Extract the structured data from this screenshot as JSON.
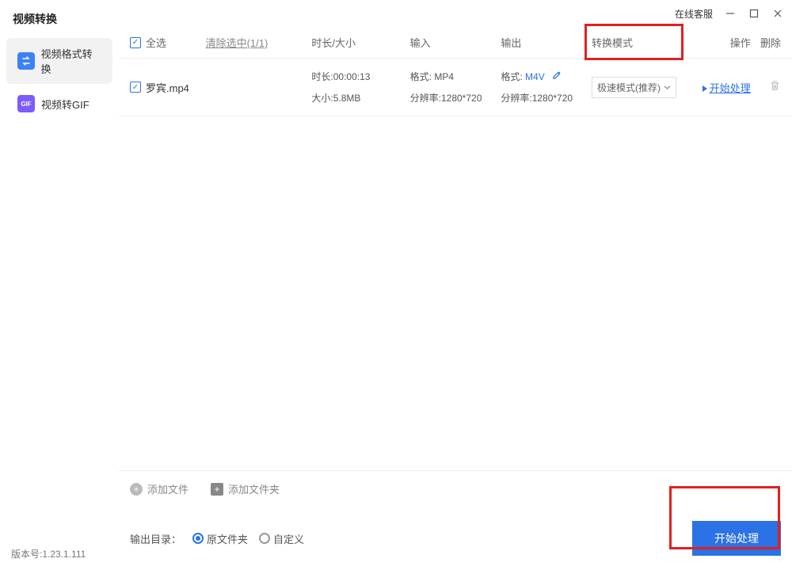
{
  "app_title": "视频转换",
  "titlebar": {
    "support": "在线客服"
  },
  "sidebar": {
    "items": [
      {
        "label": "视频格式转换"
      },
      {
        "label": "视频转GIF"
      }
    ]
  },
  "columns": {
    "select_all": "全选",
    "clear_selected": "清除选中(1/1)",
    "duration_size": "时长/大小",
    "input": "输入",
    "output": "输出",
    "mode": "转换模式",
    "ops": "操作",
    "del": "删除"
  },
  "file": {
    "name": "罗宾.mp4",
    "duration_label": "时长:",
    "duration_value": "00:00:13",
    "size_label": "大小:",
    "size_value": "5.8MB",
    "in_format_label": "格式:",
    "in_format_value": "MP4",
    "in_res_label": "分辨率:",
    "in_res_value": "1280*720",
    "out_format_label": "格式:",
    "out_format_value": "M4V",
    "out_res_label": "分辨率:",
    "out_res_value": "1280*720",
    "mode": "极速模式(推荐)",
    "start": "开始处理"
  },
  "toolbar": {
    "add_file": "添加文件",
    "add_folder": "添加文件夹"
  },
  "output_dir": {
    "label": "输出目录：",
    "original": "原文件夹",
    "custom": "自定义"
  },
  "primary_button": "开始处理",
  "version_label": "版本号:",
  "version": "1.23.1.111"
}
